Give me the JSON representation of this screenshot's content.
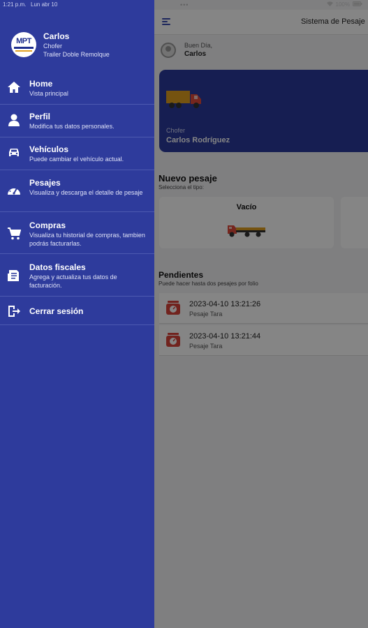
{
  "status_bar": {
    "time": "1:21 p.m.",
    "date": "Lun abr 10",
    "dots": "•••",
    "battery": "100%"
  },
  "top_bar": {
    "title": "Sistema de Pesaje"
  },
  "greeting": {
    "salutation": "Buen Día,",
    "name": "Carlos"
  },
  "driver_card": {
    "label": "Chofer",
    "name": "Carlos Rodríguez"
  },
  "nuevo_pesaje": {
    "title": "Nuevo pesaje",
    "subtitle": "Selecciona el tipo:",
    "types": [
      {
        "label": "Vacío"
      }
    ]
  },
  "pendientes": {
    "title": "Pendientes",
    "subtitle": "Puede hacer hasta dos pesajes por folio",
    "items": [
      {
        "date": "2023-04-10 13:21:26",
        "kind": "Pesaje Tara"
      },
      {
        "date": "2023-04-10 13:21:44",
        "kind": "Pesaje Tara"
      }
    ]
  },
  "drawer": {
    "logo_text": "MPT",
    "user_name": "Carlos",
    "user_role": "Chofer",
    "user_trailer": "Trailer Doble Remolque",
    "menu": [
      {
        "label": "Home",
        "desc": "Vista principal",
        "icon": "home-icon"
      },
      {
        "label": "Perfil",
        "desc": "Modifica tus datos personales.",
        "icon": "person-icon"
      },
      {
        "label": "Vehículos",
        "desc": "Puede cambiar el vehículo actual.",
        "icon": "car-icon"
      },
      {
        "label": "Pesajes",
        "desc": "Visualiza y descarga el detalle de pesaje",
        "icon": "gauge-icon"
      },
      {
        "label": "Compras",
        "desc": "Visualiza tu historial de compras, tambien podrás facturarlas.",
        "icon": "cart-icon"
      },
      {
        "label": "Datos fiscales",
        "desc": "Agrega y actualiza tus datos de facturación.",
        "icon": "invoice-icon"
      },
      {
        "label": "Cerrar sesión",
        "icon": "logout-icon"
      }
    ]
  },
  "colors": {
    "drawer_bg": "#2e3b9c",
    "card_bg": "#2b3a9e",
    "truck_cab": "#e04a3a",
    "truck_cargo": "#e0a020",
    "scale_icon": "#d9433a"
  }
}
